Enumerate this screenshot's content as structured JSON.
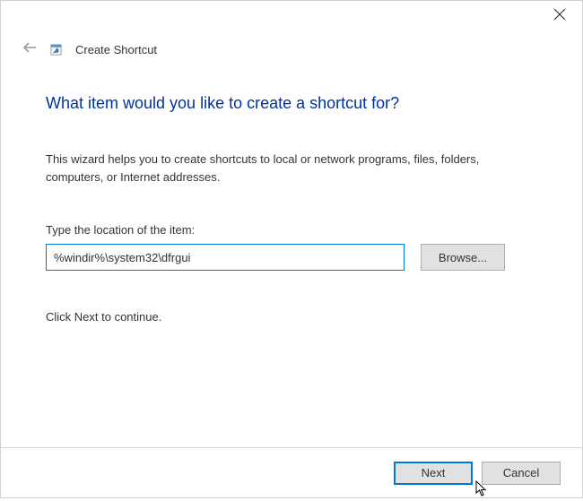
{
  "header": {
    "title": "Create Shortcut"
  },
  "main": {
    "heading": "What item would you like to create a shortcut for?",
    "description": "This wizard helps you to create shortcuts to local or network programs, files, folders, computers, or Internet addresses.",
    "input_label": "Type the location of the item:",
    "location_value": "%windir%\\system32\\dfrgui",
    "browse_label": "Browse...",
    "continue_text": "Click Next to continue."
  },
  "footer": {
    "next_label": "Next",
    "cancel_label": "Cancel"
  }
}
